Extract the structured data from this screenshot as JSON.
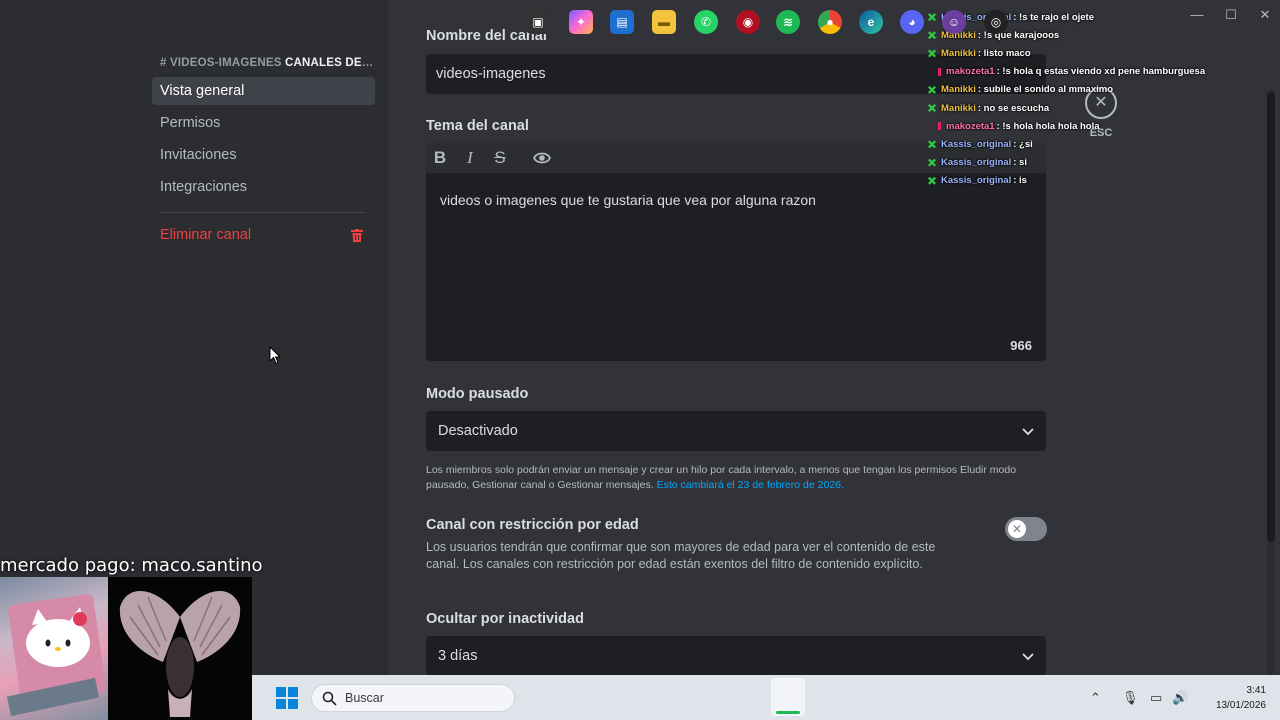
{
  "sidebar": {
    "header_channel": "# VIDEOS-IMAGENES",
    "header_category": "CANALES DE ...",
    "items": [
      {
        "label": "Vista general"
      },
      {
        "label": "Permisos"
      },
      {
        "label": "Invitaciones"
      },
      {
        "label": "Integraciones"
      }
    ],
    "delete_label": "Eliminar canal"
  },
  "main": {
    "channel_name_label": "Nombre del canal",
    "channel_name_value": "videos-imagenes",
    "topic_label": "Tema del canal",
    "topic_value": "videos o imagenes que te gustaria que vea por alguna razon",
    "topic_remaining": "966",
    "slowmode_label": "Modo pausado",
    "slowmode_value": "Desactivado",
    "slowmode_help": "Los miembros solo podrán enviar un mensaje y crear un hilo por cada intervalo, a menos que tengan los permisos Eludir modo pausado, Gestionar canal o Gestionar mensajes.",
    "slowmode_help_link": "Esto cambiará el 23 de febrero de 2026.",
    "age_label": "Canal con restricción por edad",
    "age_desc": "Los usuarios tendrán que confirmar que son mayores de edad para ver el contenido de este canal. Los canales con restricción por edad están exentos del filtro de contenido explícito.",
    "age_toggle_on": false,
    "hide_label": "Ocultar por inactividad",
    "hide_value": "3 días",
    "esc_label": "ESC"
  },
  "chat": [
    {
      "user": "Kassis_original",
      "color": "#9ab4ff",
      "msg": ": !s te rajo el ojete",
      "badge": "green"
    },
    {
      "user": "Manikki",
      "color": "#f0c040",
      "msg": ": !s que karajooos",
      "badge": "green"
    },
    {
      "user": "Manikki",
      "color": "#f0c040",
      "msg": ": listo maco",
      "badge": "green"
    },
    {
      "user": "makozeta1",
      "color": "#ff6fb0",
      "msg": ": !s hola q estas viendo xd pene hamburguesa",
      "badge": "pink"
    },
    {
      "user": "Manikki",
      "color": "#f0c040",
      "msg": ": subile el sonido al mmaximo",
      "badge": "green"
    },
    {
      "user": "Manikki",
      "color": "#f0c040",
      "msg": ": no se escucha",
      "badge": "green"
    },
    {
      "user": "makozeta1",
      "color": "#ff6fb0",
      "msg": ": !s hola hola hola hola",
      "badge": "pink"
    },
    {
      "user": "Kassis_original",
      "color": "#9ab4ff",
      "msg": ": ¿si",
      "badge": "green"
    },
    {
      "user": "Kassis_original",
      "color": "#9ab4ff",
      "msg": ": si",
      "badge": "green"
    },
    {
      "user": "Kassis_original",
      "color": "#9ab4ff",
      "msg": ": is",
      "badge": "green"
    }
  ],
  "stream_overlay": {
    "donation_text": "mercado pago: maco.santino"
  },
  "taskbar": {
    "search_placeholder": "Buscar",
    "time": "3:41",
    "date": "13/01/2026"
  },
  "colors": {
    "accent_link": "#00a8fc",
    "danger": "#f23f43",
    "bg_main": "#313338",
    "bg_sidebar": "#2b2d31"
  }
}
